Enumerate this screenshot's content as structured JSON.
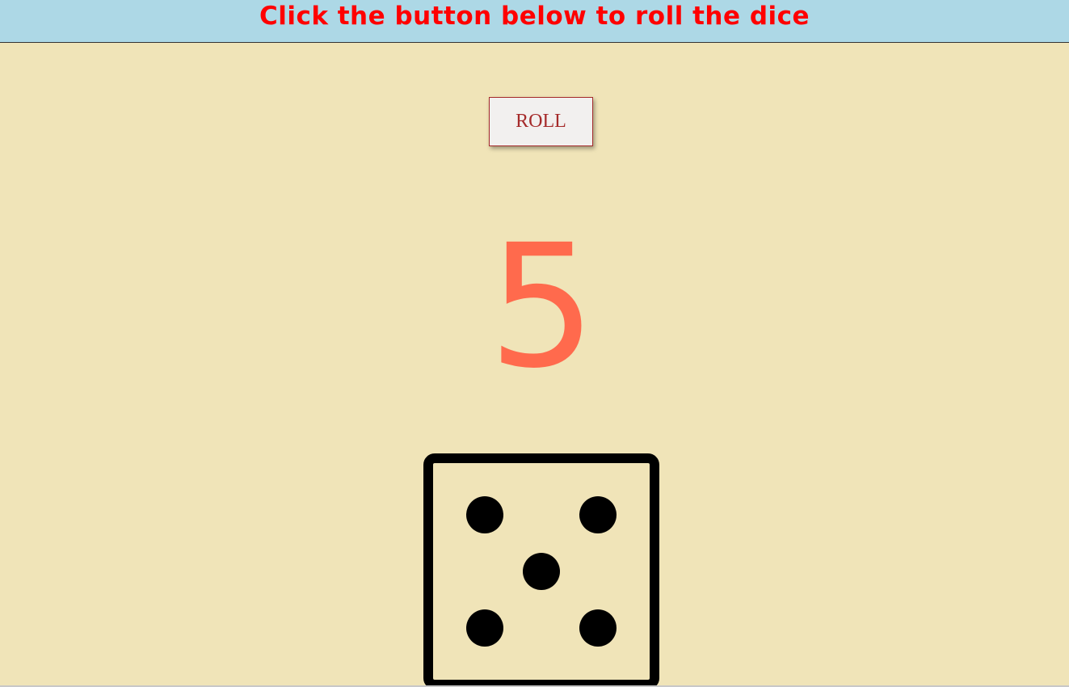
{
  "header": {
    "title": "Click the button below to roll the dice"
  },
  "controls": {
    "roll_label": "ROLL"
  },
  "result": {
    "value": "5"
  },
  "dice": {
    "face_value": 5,
    "icon": "dice-five-icon"
  },
  "colors": {
    "background": "#f0e4b8",
    "header_bg": "#add8e6",
    "title": "#ff0000",
    "result": "#ff6a4d",
    "button_text": "#a52a2a"
  }
}
